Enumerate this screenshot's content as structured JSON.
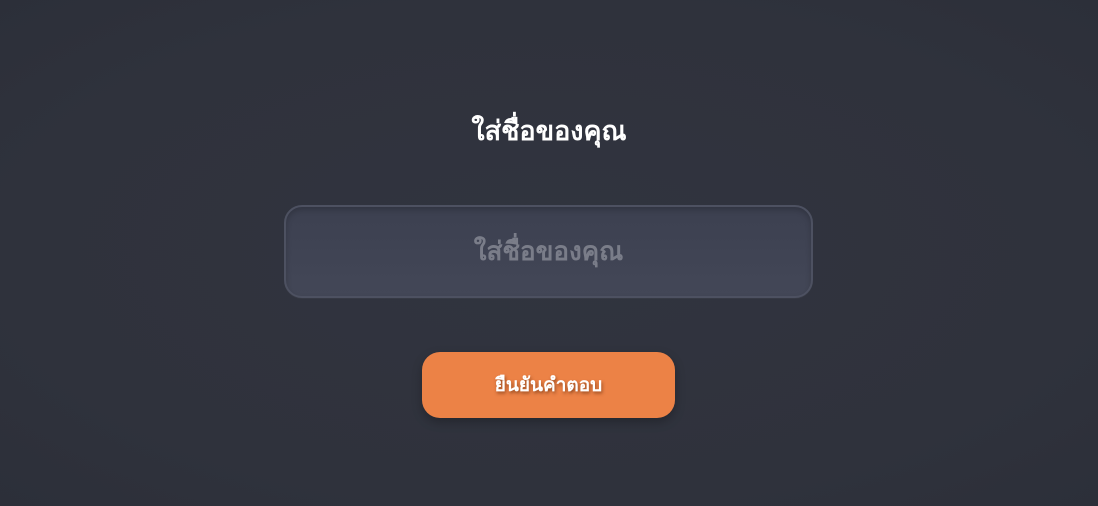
{
  "form": {
    "title": "ใส่ชื่อของคุณ",
    "name_input": {
      "value": "",
      "placeholder": "ใส่ชื่อของคุณ"
    },
    "submit_label": "ยืนยันคำตอบ"
  },
  "colors": {
    "background": "#30333e",
    "input_background": "#404454",
    "input_border": "#4d5161",
    "placeholder_text": "#7a7d89",
    "accent": "#ec8246",
    "text": "#ffffff"
  }
}
